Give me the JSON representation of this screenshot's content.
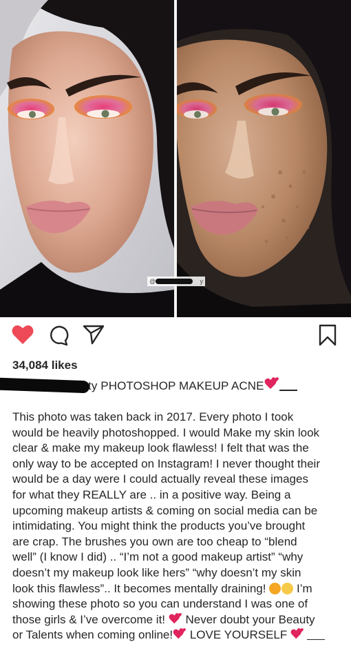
{
  "post": {
    "watermark_prefix": "@",
    "watermark_suffix": "y",
    "likes": "34,084 likes",
    "username_tail": "ty",
    "caption_title": "PHOTOSHOP MAKEUP ACNE",
    "caption_lines": [
      "This photo was taken back in 2017. Every photo I took",
      "would be heavily photoshopped. I would Make my skin look",
      "clear & make my makeup look flawless! I felt that was the",
      "only way to be accepted on Instagram! I never thought their",
      "would be a day were I could actually reveal these images",
      "for what they REALLY are .. in a positive way. Being a",
      "upcoming makeup artists & coming on social media can be",
      "intimidating. You might think the products you’ve brought",
      "are crap. The brushes you own are too cheap to “blend",
      "well” (I know I did) .. “I’m not a good makeup artist” “why",
      "doesn’t my makeup look like hers” “why doesn’t my skin",
      "look this flawless”.. It becomes mentally draining!",
      "I’m",
      "showing these photo so you can understand I was one of",
      "those girls & I’ve overcome it!",
      "Never doubt your Beauty",
      "or Talents when coming online!",
      "LOVE YOURSELF"
    ]
  },
  "icons": {
    "like": "heart-icon",
    "comment": "comment-icon",
    "share": "send-icon",
    "save": "bookmark-icon"
  },
  "colors": {
    "like_red": "#ed4956",
    "emoji_heart": "#e0245e",
    "text": "#262626"
  }
}
